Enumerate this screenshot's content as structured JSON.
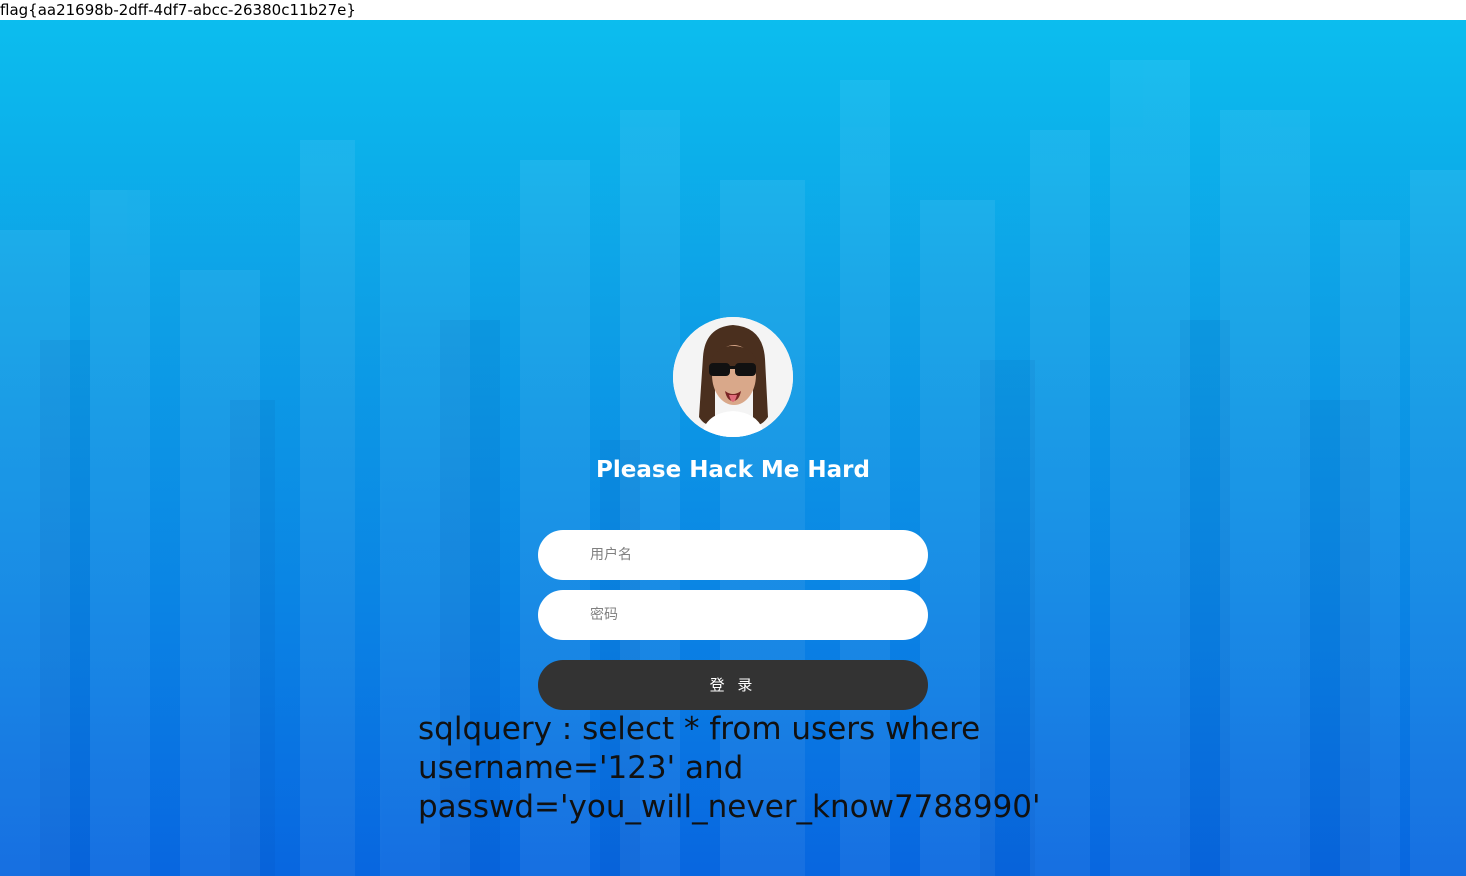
{
  "flag_text": "flag{aa21698b-2dff-4df7-abcc-26380c11b27e}",
  "login": {
    "title": "Please Hack Me Hard",
    "username_placeholder": "用户名",
    "password_placeholder": "密码",
    "submit_label": "登 录"
  },
  "sql_output": {
    "lines": [
      "sqlquery : select * from users where",
      "username='123' and",
      "passwd='you_will_never_know7788990'"
    ]
  },
  "icons": {
    "avatar": "avatar-photo-sunglasses"
  },
  "colors": {
    "background_top": "#0cbdee",
    "background_bottom": "#0866e0",
    "button": "#333333",
    "title": "#ffffff",
    "field": "#ffffff"
  }
}
